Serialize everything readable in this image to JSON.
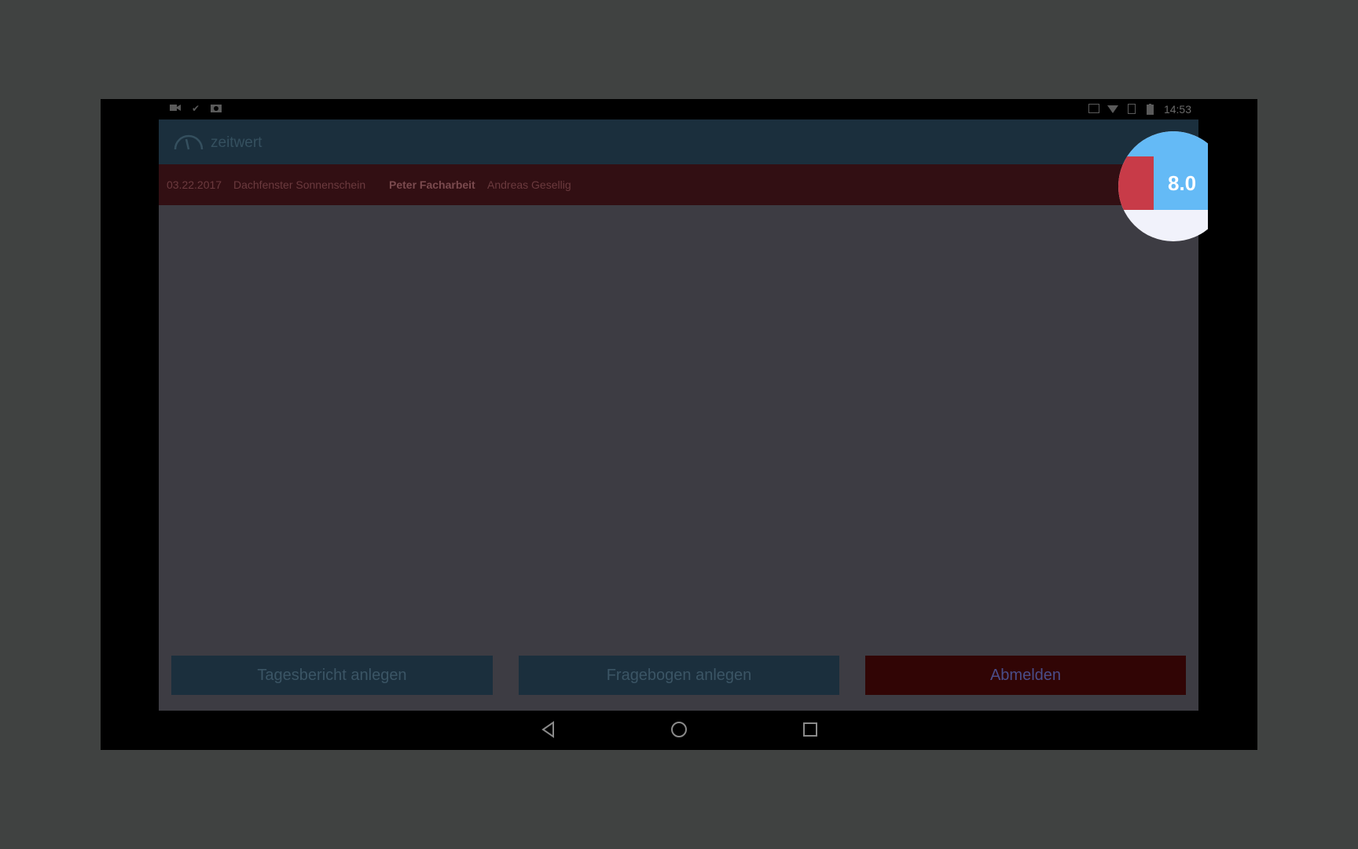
{
  "statusbar": {
    "time": "14:53",
    "left_icons": [
      "video-icon",
      "check-icon",
      "camera-icon"
    ],
    "right_icons": [
      "cast-icon",
      "wifi-icon",
      "sim-icon",
      "battery-icon"
    ]
  },
  "appbar": {
    "logo_text": "zeitwert"
  },
  "infobar": {
    "date": "03.22.2017",
    "project": "Dachfenster Sonnenschein",
    "user_primary": "Peter Facharbeit",
    "user_secondary": "Andreas Gesellig"
  },
  "hours_badge": {
    "value": "8.0"
  },
  "buttons": {
    "daily_report": "Tagesbericht anlegen",
    "questionnaire": "Fragebogen anlegen",
    "logout": "Abmelden"
  },
  "colors": {
    "appbar": "#1b2f3d",
    "infobar": "#320f13",
    "content": "#3d3c43",
    "logout": "#310505",
    "badge_blue": "#64baf6",
    "badge_red": "#c83b48"
  }
}
